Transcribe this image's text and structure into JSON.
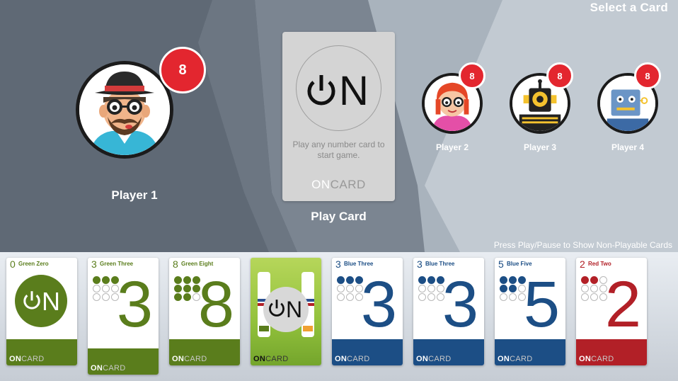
{
  "screen_title": "Select a Card",
  "hint": "Press Play/Pause to Show Non-Playable Cards",
  "players": [
    {
      "name": "Player 1",
      "count": "8",
      "avatar": "man-hat-glasses-avatar"
    },
    {
      "name": "Player 2",
      "count": "8",
      "avatar": "woman-red-hair-avatar"
    },
    {
      "name": "Player 3",
      "count": "8",
      "avatar": "robot-yellow-avatar"
    },
    {
      "name": "Player 4",
      "count": "8",
      "avatar": "robot-blue-avatar"
    }
  ],
  "play_card": {
    "logo_text": "N",
    "instruction": "Play any number card to start game.",
    "brand_on": "ON",
    "brand_card": "CARD",
    "label": "Play Card"
  },
  "hand": [
    {
      "number": "0",
      "name": "Green Zero",
      "color": "#5a7d1c",
      "type": "zero",
      "filled": 0
    },
    {
      "number": "3",
      "name": "Green Three",
      "color": "#5a7d1c",
      "type": "number",
      "filled": 3
    },
    {
      "number": "8",
      "name": "Green Eight",
      "color": "#5a7d1c",
      "type": "number",
      "filled": 8
    },
    {
      "number": "",
      "name": "",
      "color": "#8dbb3a",
      "type": "wild",
      "filled": 0
    },
    {
      "number": "3",
      "name": "Blue Three",
      "color": "#1c4e85",
      "type": "number",
      "filled": 3
    },
    {
      "number": "3",
      "name": "Blue Three",
      "color": "#1c4e85",
      "type": "number",
      "filled": 3
    },
    {
      "number": "5",
      "name": "Blue Five",
      "color": "#1c4e85",
      "type": "number",
      "filled": 5
    },
    {
      "number": "2",
      "name": "Red Two",
      "color": "#b22027",
      "type": "number",
      "filled": 2
    }
  ],
  "card_brand": {
    "on": "ON",
    "card": "CARD"
  },
  "colors": {
    "badge": "#e3262f",
    "green": "#5a7d1c",
    "blue": "#1c4e85",
    "red": "#b22027"
  }
}
